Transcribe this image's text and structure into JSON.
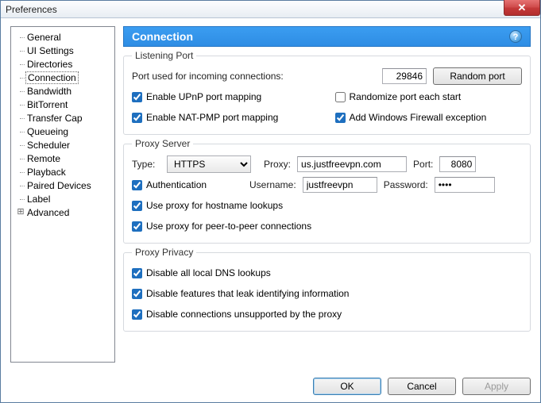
{
  "window": {
    "title": "Preferences"
  },
  "sidebar": {
    "items": [
      {
        "label": "General"
      },
      {
        "label": "UI Settings"
      },
      {
        "label": "Directories"
      },
      {
        "label": "Connection"
      },
      {
        "label": "Bandwidth"
      },
      {
        "label": "BitTorrent"
      },
      {
        "label": "Transfer Cap"
      },
      {
        "label": "Queueing"
      },
      {
        "label": "Scheduler"
      },
      {
        "label": "Remote"
      },
      {
        "label": "Playback"
      },
      {
        "label": "Paired Devices"
      },
      {
        "label": "Label"
      },
      {
        "label": "Advanced"
      }
    ]
  },
  "banner": {
    "title": "Connection"
  },
  "listening": {
    "legend": "Listening Port",
    "port_label": "Port used for incoming connections:",
    "port_value": "29846",
    "random_btn": "Random port",
    "upnp": "Enable UPnP port mapping",
    "randomize": "Randomize port each start",
    "natpmp": "Enable NAT-PMP port mapping",
    "firewall": "Add Windows Firewall exception"
  },
  "proxy": {
    "legend": "Proxy Server",
    "type_label": "Type:",
    "type_value": "HTTPS",
    "proxy_label": "Proxy:",
    "proxy_value": "us.justfreevpn.com",
    "port_label": "Port:",
    "port_value": "8080",
    "auth": "Authentication",
    "user_label": "Username:",
    "user_value": "justfreevpn",
    "pass_label": "Password:",
    "pass_value": "••••",
    "hostname": "Use proxy for hostname lookups",
    "p2p": "Use proxy for peer-to-peer connections"
  },
  "privacy": {
    "legend": "Proxy Privacy",
    "dns": "Disable all local DNS lookups",
    "leak": "Disable features that leak identifying information",
    "unsupported": "Disable connections unsupported by the proxy"
  },
  "footer": {
    "ok": "OK",
    "cancel": "Cancel",
    "apply": "Apply"
  }
}
